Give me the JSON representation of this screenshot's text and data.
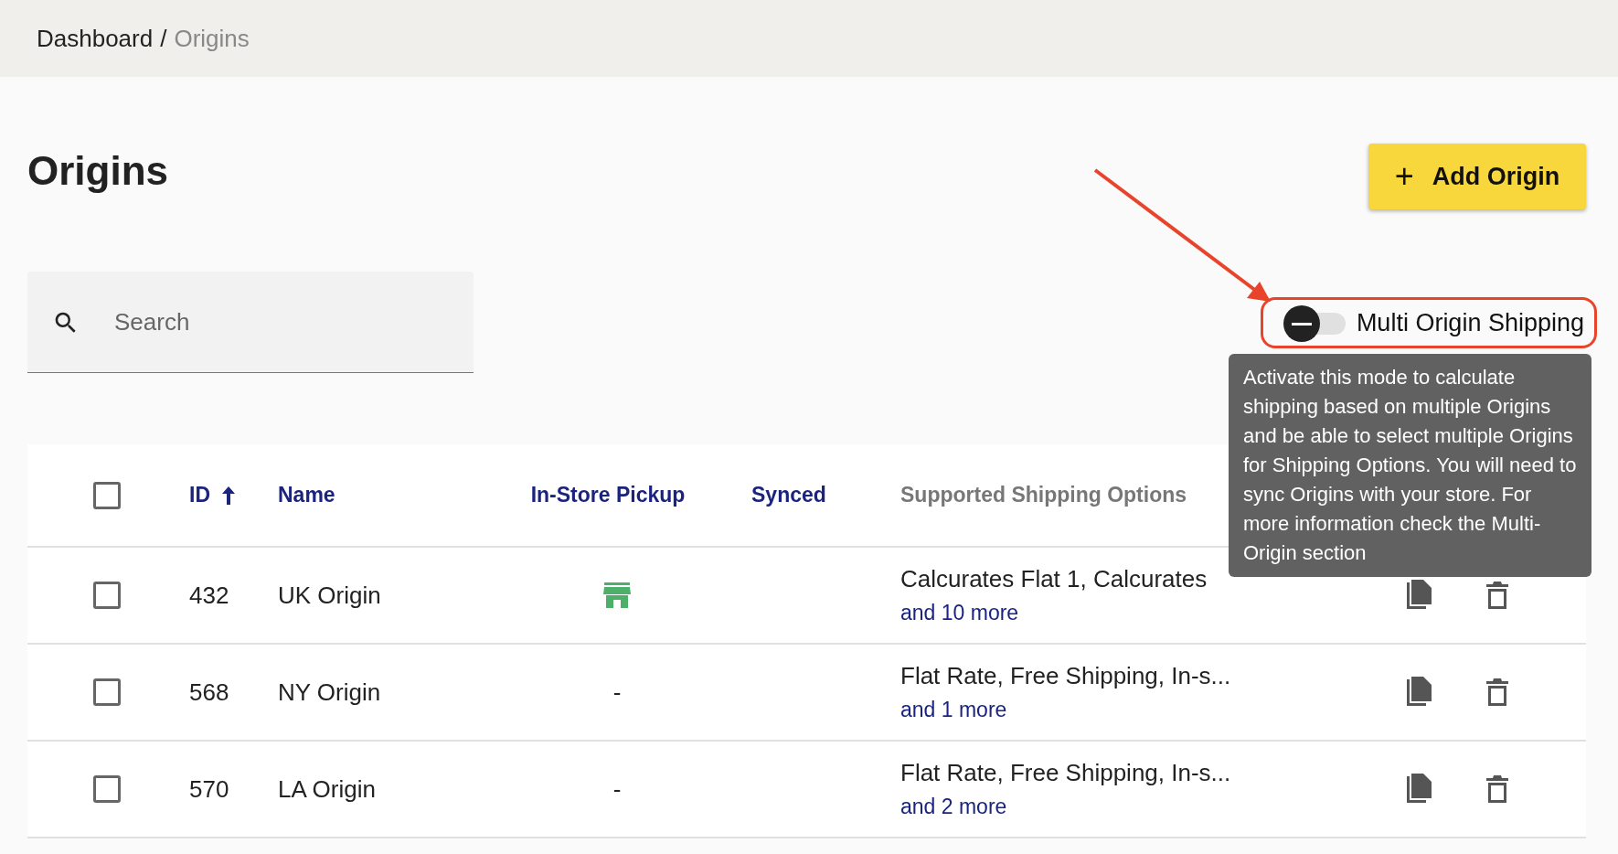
{
  "breadcrumb": [
    {
      "label": "Dashboard",
      "current": false
    },
    {
      "label": "Origins",
      "current": true
    }
  ],
  "breadcrumb_separator": "/",
  "title": "Origins",
  "add_button": {
    "label": "Add Origin",
    "icon": "+"
  },
  "search": {
    "placeholder": "Search"
  },
  "multi_origin_toggle": {
    "label": "Multi Origin Shipping",
    "on": false
  },
  "tooltip": "Activate this mode to calculate shipping based on multiple Origins and be able to select multiple Origins for Shipping Options. You will need to sync Origins with your store. For more information check the Multi-Origin section",
  "table": {
    "select_all_checked": false,
    "columns": [
      {
        "label": "ID",
        "sortable": true,
        "sorted_ascending": true
      },
      {
        "label": "Name",
        "sortable": true,
        "sorted_ascending": false
      },
      {
        "label": "In-Store Pickup",
        "sortable": true,
        "sorted_ascending": false
      },
      {
        "label": "Synced",
        "sortable": true,
        "sorted_ascending": false
      },
      {
        "label": "Supported Shipping Options",
        "sortable": false,
        "sorted_ascending": false
      }
    ],
    "rows": [
      {
        "checked": false,
        "id": "432",
        "name": "UK Origin",
        "pickup": {
          "kind": "icon"
        },
        "shipping": "Calcurates Flat 1, Calcurates",
        "more": "and 10 more"
      },
      {
        "checked": false,
        "id": "568",
        "name": "NY Origin",
        "pickup": {
          "kind": "text",
          "text": "-"
        },
        "shipping": "Flat Rate, Free Shipping, In-s...",
        "more": "and 1 more"
      },
      {
        "checked": false,
        "id": "570",
        "name": "LA Origin",
        "pickup": {
          "kind": "text",
          "text": "-"
        },
        "shipping": "Flat Rate, Free Shipping, In-s...",
        "more": "and 2 more"
      }
    ]
  }
}
